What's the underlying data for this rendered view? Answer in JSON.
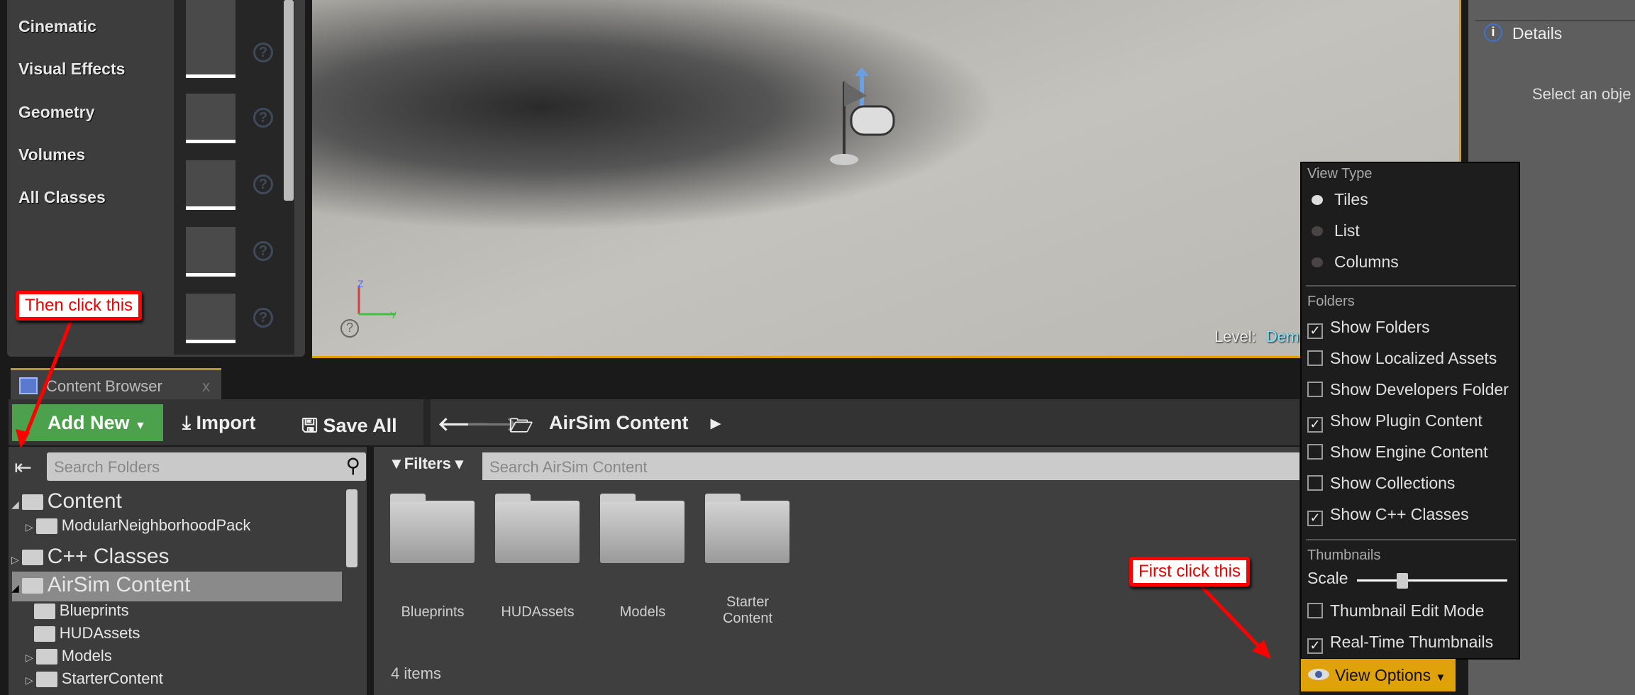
{
  "place_panel": {
    "categories": [
      "Cinematic",
      "Visual Effects",
      "Geometry",
      "Volumes",
      "All Classes"
    ],
    "thumbnails": [
      "actor-icon",
      "pawn-icon",
      "point-light-icon",
      "player-start-icon",
      "cube-icon",
      "sphere-icon"
    ],
    "help_icon": "question-circle-icon"
  },
  "viewport": {
    "level_label": "Level:",
    "level_name": "Dem",
    "accent": "#e0a000"
  },
  "details": {
    "tab": "Details",
    "message": "Select an obje"
  },
  "content_browser": {
    "tab": "Content Browser",
    "close": "x",
    "toolbar": {
      "add_new": "Add New",
      "import": "Import",
      "save_all": "Save All",
      "path": "AirSim Content"
    },
    "search_folders_placeholder": "Search Folders",
    "filters": "Filters",
    "search_assets_placeholder": "Search AirSim Content",
    "tree": [
      {
        "label": "Content",
        "level": 0,
        "expanded": true
      },
      {
        "label": "ModularNeighborhoodPack",
        "level": 1,
        "expanded": false
      },
      {
        "label": "C++ Classes",
        "level": 0,
        "expanded": false
      },
      {
        "label": "AirSim Content",
        "level": 0,
        "expanded": true,
        "selected": true
      },
      {
        "label": "Blueprints",
        "level": 1
      },
      {
        "label": "HUDAssets",
        "level": 1
      },
      {
        "label": "Models",
        "level": 1,
        "expanded": false
      },
      {
        "label": "StarterContent",
        "level": 1,
        "expanded": false
      }
    ],
    "assets": [
      "Blueprints",
      "HUDAssets",
      "Models",
      "Starter Content"
    ],
    "item_count": "4 items",
    "view_options": "View Options"
  },
  "menu": {
    "view_type_header": "View Type",
    "view_types": [
      {
        "label": "Tiles",
        "selected": true
      },
      {
        "label": "List",
        "selected": false
      },
      {
        "label": "Columns",
        "selected": false
      }
    ],
    "folders_header": "Folders",
    "folder_options": [
      {
        "label": "Show Folders",
        "checked": true
      },
      {
        "label": "Show Localized Assets",
        "checked": false
      },
      {
        "label": "Show Developers Folder",
        "checked": false
      },
      {
        "label": "Show Plugin Content",
        "checked": true
      },
      {
        "label": "Show Engine Content",
        "checked": false
      },
      {
        "label": "Show Collections",
        "checked": false
      },
      {
        "label": "Show C++ Classes",
        "checked": true
      }
    ],
    "thumbnails_header": "Thumbnails",
    "scale_label": "Scale",
    "scale_value": 0.3,
    "thumb_options": [
      {
        "label": "Thumbnail Edit Mode",
        "checked": false
      },
      {
        "label": "Real-Time Thumbnails",
        "checked": true
      }
    ]
  },
  "annotations": {
    "first": "First click this",
    "then": "Then click this",
    "color": "#ff0000"
  }
}
